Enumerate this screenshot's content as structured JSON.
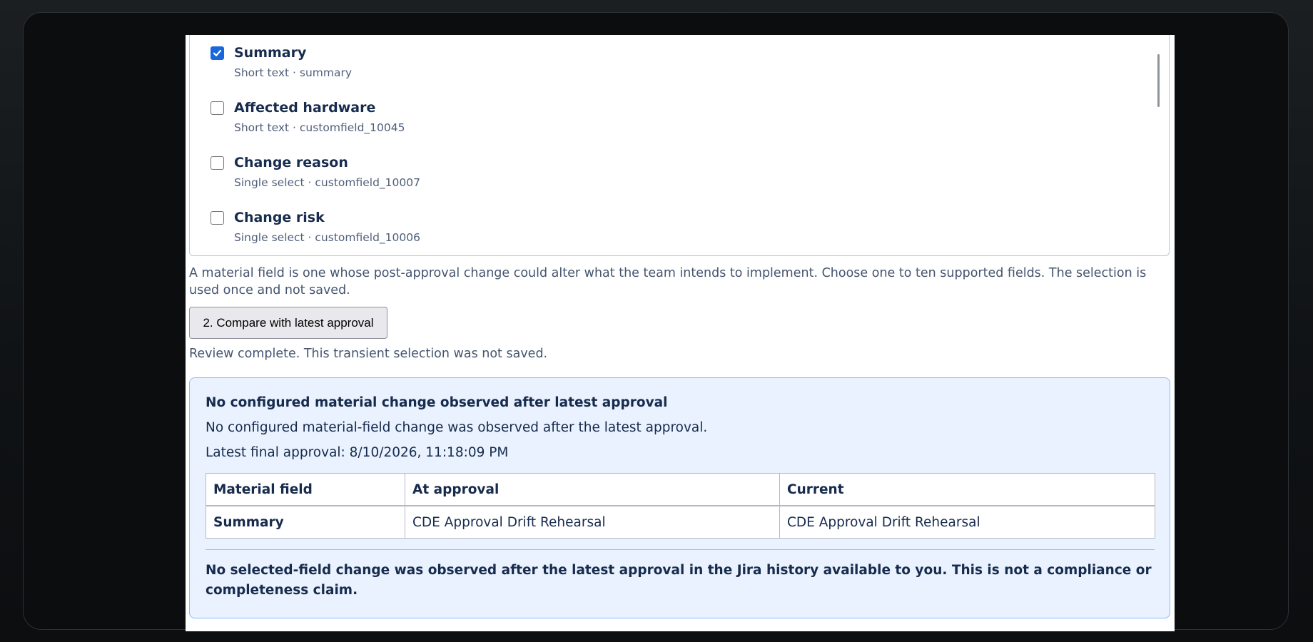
{
  "fields": [
    {
      "name": "Summary",
      "meta": "Short text · summary",
      "checked": true
    },
    {
      "name": "Affected hardware",
      "meta": "Short text · customfield_10045",
      "checked": false
    },
    {
      "name": "Change reason",
      "meta": "Single select · customfield_10007",
      "checked": false
    },
    {
      "name": "Change risk",
      "meta": "Single select · customfield_10006",
      "checked": false
    }
  ],
  "help_text": "A material field is one whose post-approval change could alter what the team intends to implement. Choose one to ten supported fields. The selection is used once and not saved.",
  "compare_button_label": "2. Compare with latest approval",
  "status_text": "Review complete. This transient selection was not saved.",
  "result": {
    "title": "No configured material change observed after latest approval",
    "message": "No configured material-field change was observed after the latest approval.",
    "latest_approval": "Latest final approval: 8/10/2026, 11:18:09 PM",
    "table": {
      "headers": [
        "Material field",
        "At approval",
        "Current"
      ],
      "rows": [
        [
          "Summary",
          "CDE Approval Drift Rehearsal",
          "CDE Approval Drift Rehearsal"
        ]
      ]
    },
    "disclaimer": "No selected-field change was observed after the latest approval in the Jira history available to you. This is not a compliance or completeness claim."
  },
  "colors": {
    "checkbox_checked": "#1868db",
    "result_background": "#e9f2fe",
    "result_border": "#8fb8f6",
    "text_primary": "#172b4d"
  }
}
